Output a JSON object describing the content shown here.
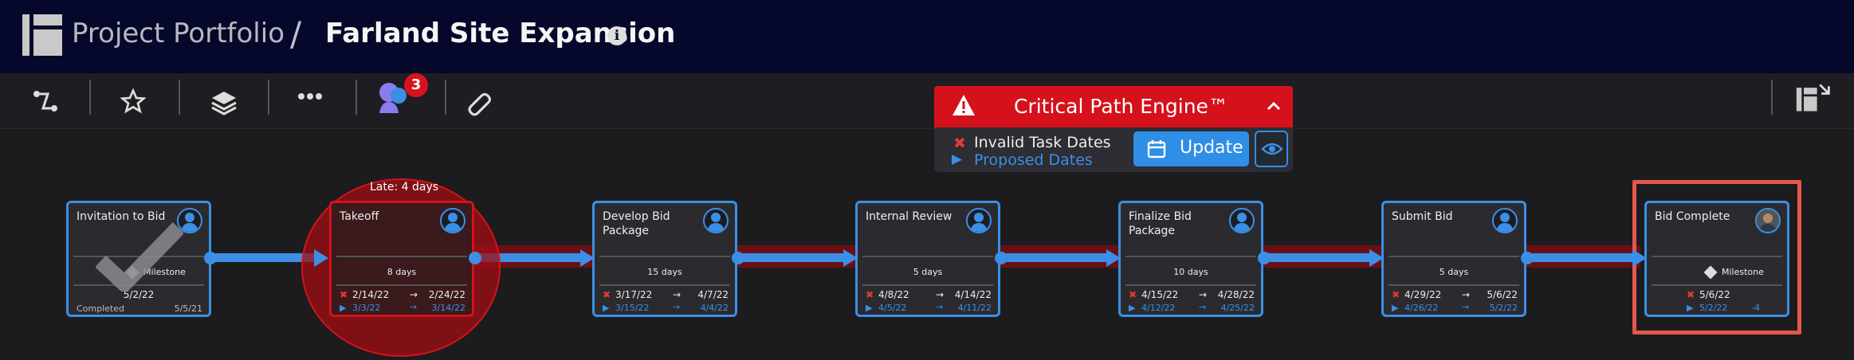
{
  "header": {
    "breadcrumb_parent": "Project Portfolio",
    "separator": "/",
    "project_title": "Farland Site Expansion",
    "info_label": "i"
  },
  "toolbar": {
    "icons": [
      "route-icon",
      "star-icon",
      "layers-icon",
      "more-icon",
      "team-icon",
      "attachment-icon"
    ],
    "team_badge_count": "3",
    "right_icon": "collapse-panel-icon"
  },
  "critical_path": {
    "title": "Critical Path Engine™",
    "invalid_label": "Invalid Task Dates",
    "proposed_label": "Proposed Dates",
    "update_label": "Update",
    "colors": {
      "header": "#d5121b",
      "accent": "#2f8ee6"
    }
  },
  "late_label": "Late: 4 days",
  "tasks": [
    {
      "name": "Invitation to Bid",
      "type": "milestone",
      "duration": "Milestone",
      "start": "5/2/22",
      "status": "Completed",
      "completed": "5/5/21"
    },
    {
      "name": "Takeoff",
      "type": "task",
      "duration": "8 days",
      "start": "2/14/22",
      "end": "2/24/22",
      "proposed_start": "3/3/22",
      "proposed_end": "3/14/22",
      "late": true
    },
    {
      "name": "Develop Bid Package",
      "type": "task",
      "duration": "15 days",
      "start": "3/17/22",
      "end": "4/7/22",
      "proposed_start": "3/15/22",
      "proposed_end": "4/4/22"
    },
    {
      "name": "Internal Review",
      "type": "task",
      "duration": "5 days",
      "start": "4/8/22",
      "end": "4/14/22",
      "proposed_start": "4/5/22",
      "proposed_end": "4/11/22"
    },
    {
      "name": "Finalize Bid Package",
      "type": "task",
      "duration": "10 days",
      "start": "4/15/22",
      "end": "4/28/22",
      "proposed_start": "4/12/22",
      "proposed_end": "4/25/22"
    },
    {
      "name": "Submit Bid",
      "type": "task",
      "duration": "5 days",
      "start": "4/29/22",
      "end": "5/6/22",
      "proposed_start": "4/26/22",
      "proposed_end": "5/2/22"
    },
    {
      "name": "Bid Complete",
      "type": "milestone",
      "duration": "Milestone",
      "start": "5/6/22",
      "proposed_start": "5/2/22",
      "variance": "-4"
    }
  ],
  "glyphs": {
    "arrow": "→",
    "x": "✖",
    "play": "▶"
  }
}
